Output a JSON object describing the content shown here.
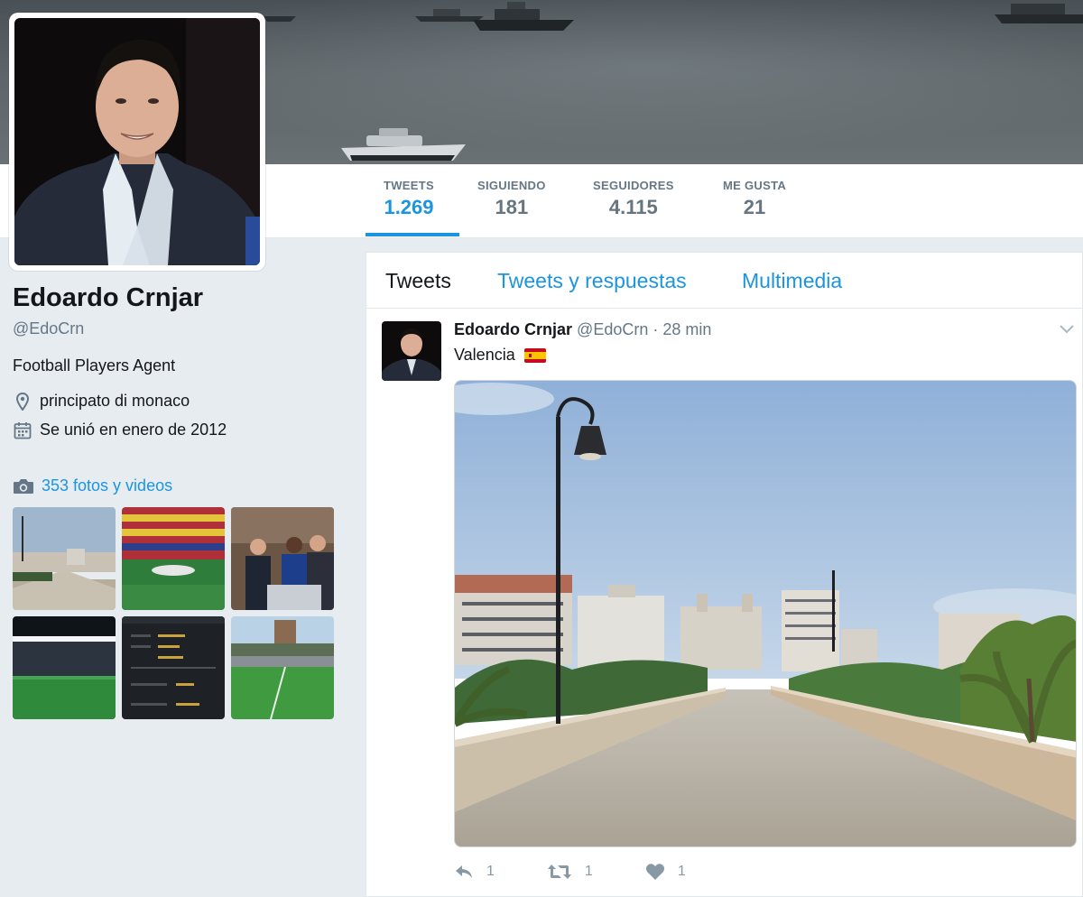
{
  "profile": {
    "name": "Edoardo Crnjar",
    "handle": "@EdoCrn",
    "bio": "Football Players Agent",
    "location": "principato di monaco",
    "joined": "Se unió en enero de 2012",
    "photos_link": "353 fotos y videos"
  },
  "stats": [
    {
      "label": "TWEETS",
      "value": "1.269",
      "active": true
    },
    {
      "label": "SIGUIENDO",
      "value": "181"
    },
    {
      "label": "SEGUIDORES",
      "value": "4.115"
    },
    {
      "label": "ME GUSTA",
      "value": "21"
    }
  ],
  "tabs": [
    {
      "label": "Tweets"
    },
    {
      "label": "Tweets y respuestas"
    },
    {
      "label": "Multimedia"
    }
  ],
  "tweet": {
    "name": "Edoardo Crnjar",
    "handle": "@EdoCrn",
    "separator": "·",
    "time": "28 min",
    "text": "Valencia",
    "flag": "spain-flag",
    "actions": {
      "reply_count": "1",
      "retweet_count": "1",
      "like_count": "1"
    }
  },
  "colors": {
    "accent": "#1b95e0",
    "background": "#e6ecf0",
    "muted": "#657786"
  },
  "icons": [
    "location-icon",
    "calendar-icon",
    "camera-icon",
    "chevron-down-icon",
    "reply-icon",
    "retweet-icon",
    "heart-icon"
  ]
}
